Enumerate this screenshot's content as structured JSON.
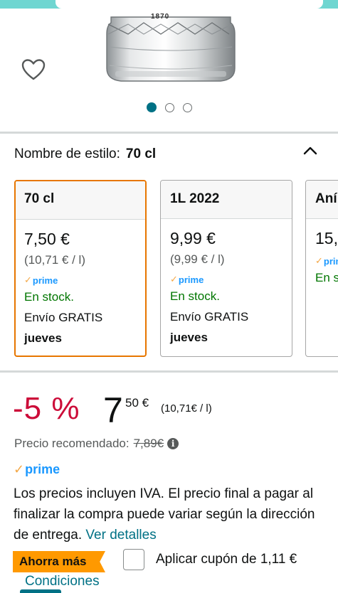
{
  "gallery": {
    "image_label": "1870",
    "dots_count": 3,
    "active_dot": 0,
    "wishlist_icon": "heart-icon"
  },
  "style": {
    "label": "Nombre de estilo:",
    "selected": "70 cl",
    "collapse_icon": "chevron-up-icon"
  },
  "options": [
    {
      "name": "70 cl",
      "price": "7,50 €",
      "unit": "(10,71 € / l)",
      "prime": "prime",
      "stock": "En stock.",
      "shipping": "Envío GRATIS",
      "day": "jueves",
      "selected": true
    },
    {
      "name": "1L 2022",
      "price": "9,99 €",
      "unit": "(9,99 € / l)",
      "prime": "prime",
      "stock": "En stock.",
      "shipping": "Envío GRATIS",
      "day": "jueves",
      "selected": false
    },
    {
      "name": "Aní",
      "price": "15,",
      "unit": "",
      "prime": "prim",
      "stock": "En s",
      "shipping": "",
      "day": "",
      "selected": false
    }
  ],
  "pricing": {
    "discount": "-5 %",
    "whole": "7",
    "cents": "50 €",
    "per_unit": "(10,71€ / l)",
    "recommended_label": "Precio recomendado:",
    "recommended_value": "7,89€",
    "prime_label": "prime",
    "iva_text": "Los precios incluyen IVA. El precio final a pagar al finalizar la compra puede variar según la dirección de entrega.",
    "details_link": "Ver detalles"
  },
  "coupon": {
    "badge": "Ahorra más",
    "label": "Aplicar cupón de 1,11 €",
    "conditions": "Condiciones"
  },
  "colors": {
    "accent": "#007185",
    "discount": "#cc0c39",
    "badge": "#ff9900",
    "stock": "#007600",
    "selected_border": "#e77600",
    "top_bar": "#6fd6d1"
  }
}
